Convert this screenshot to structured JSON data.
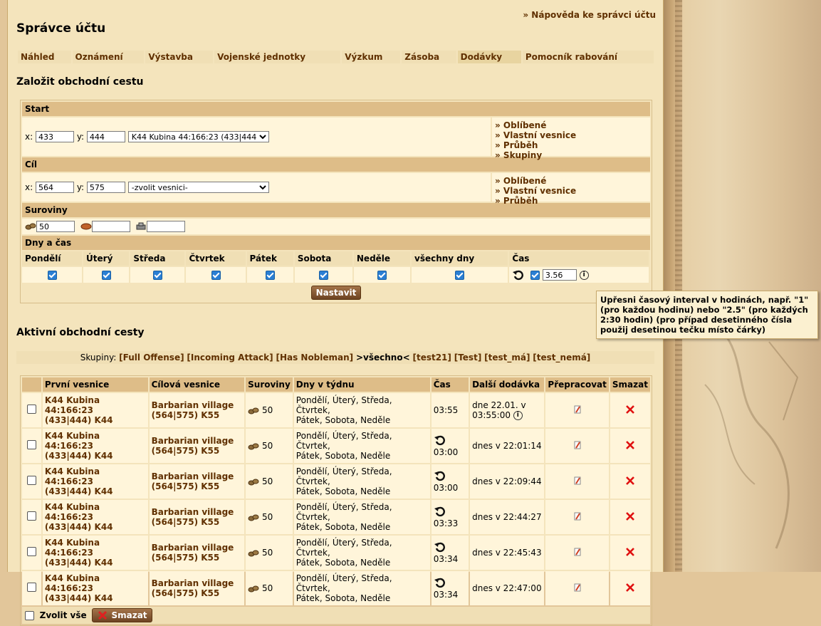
{
  "help_link": "» Nápověda ke správci účtu",
  "page_title": "Správce účtu",
  "menu": [
    "Náhled",
    "Oznámení",
    "Výstavba",
    "Vojenské jednotky",
    "Výzkum",
    "Zásoba",
    "Dodávky",
    "Pomocník rabování"
  ],
  "create_heading": "Založit obchodní cestu",
  "start": {
    "label": "Start",
    "x_label": "x:",
    "x_value": "433",
    "y_label": "y:",
    "y_value": "444",
    "village_select": "K44 Kubina 44:166:23 (433|444) K44",
    "links": [
      "» Oblíbené",
      "» Vlastní vesnice",
      "» Průběh",
      "» Skupiny"
    ]
  },
  "target": {
    "label": "Cíl",
    "x_label": "x:",
    "x_value": "564",
    "y_label": "y:",
    "y_value": "575",
    "village_select": "-zvolit vesnici-",
    "links": [
      "» Oblíbené",
      "» Vlastní vesnice",
      "» Průběh"
    ]
  },
  "resources": {
    "label": "Suroviny",
    "wood": "50",
    "clay": "",
    "iron": ""
  },
  "days_time": {
    "label": "Dny a čas",
    "days": [
      "Pondělí",
      "Úterý",
      "Středa",
      "Čtvrtek",
      "Pátek",
      "Sobota",
      "Neděle",
      "všechny dny",
      "Čas"
    ],
    "interval": "3.56"
  },
  "submit": "Nastavit",
  "tooltip": "Upřesni časový interval v hodinách, např. \"1\" (pro každou hodinu) nebo \"2.5\" (pro každých 2:30 hodin) (pro případ desetinného čísla použij desetinou tečku místo čárky)",
  "active_heading": "Aktivní obchodní cesty",
  "groups": {
    "label": "Skupiny:",
    "items": [
      "[Full Offense]",
      "[Incoming Attack]",
      "[Has Nobleman]",
      ">všechno<",
      "[test21]",
      "[Test]",
      "[test_má]",
      "[test_nemá]"
    ]
  },
  "table": {
    "headers": [
      "První vesnice",
      "Cílová vesnice",
      "Suroviny",
      "Dny v týdnu",
      "Čas",
      "Další dodávka",
      "Přepracovat",
      "Smazat"
    ],
    "rows": [
      {
        "from1": "K44 Kubina 44:166:23",
        "from2": "(433|444) K44",
        "to1": "Barbarian village",
        "to2": "(564|575) K55",
        "res": "50",
        "days1": "Pondělí, Úterý, Středa, Čtvrtek,",
        "days2": "Pátek, Sobota, Neděle",
        "time": "03:55",
        "next1": "dne 22.01. v",
        "next2": "03:55:00"
      },
      {
        "from1": "K44 Kubina 44:166:23",
        "from2": "(433|444) K44",
        "to1": "Barbarian village",
        "to2": "(564|575) K55",
        "res": "50",
        "days1": "Pondělí, Úterý, Středa, Čtvrtek,",
        "days2": "Pátek, Sobota, Neděle",
        "time": "03:00",
        "next1": "dnes v 22:01:14",
        "next2": ""
      },
      {
        "from1": "K44 Kubina 44:166:23",
        "from2": "(433|444) K44",
        "to1": "Barbarian village",
        "to2": "(564|575) K55",
        "res": "50",
        "days1": "Pondělí, Úterý, Středa, Čtvrtek,",
        "days2": "Pátek, Sobota, Neděle",
        "time": "03:00",
        "next1": "dnes v 22:09:44",
        "next2": ""
      },
      {
        "from1": "K44 Kubina 44:166:23",
        "from2": "(433|444) K44",
        "to1": "Barbarian village",
        "to2": "(564|575) K55",
        "res": "50",
        "days1": "Pondělí, Úterý, Středa, Čtvrtek,",
        "days2": "Pátek, Sobota, Neděle",
        "time": "03:33",
        "next1": "dnes v 22:44:27",
        "next2": ""
      },
      {
        "from1": "K44 Kubina 44:166:23",
        "from2": "(433|444) K44",
        "to1": "Barbarian village",
        "to2": "(564|575) K55",
        "res": "50",
        "days1": "Pondělí, Úterý, Středa, Čtvrtek,",
        "days2": "Pátek, Sobota, Neděle",
        "time": "03:34",
        "next1": "dnes v 22:45:43",
        "next2": ""
      },
      {
        "from1": "K44 Kubina 44:166:23",
        "from2": "(433|444) K44",
        "to1": "Barbarian village",
        "to2": "(564|575) K55",
        "res": "50",
        "days1": "Pondělí, Úterý, Středa, Čtvrtek,",
        "days2": "Pátek, Sobota, Neděle",
        "time": "03:34",
        "next1": "dnes v 22:47:00",
        "next2": ""
      }
    ],
    "select_all": "Zvolit vše",
    "delete_button": "Smazat"
  }
}
